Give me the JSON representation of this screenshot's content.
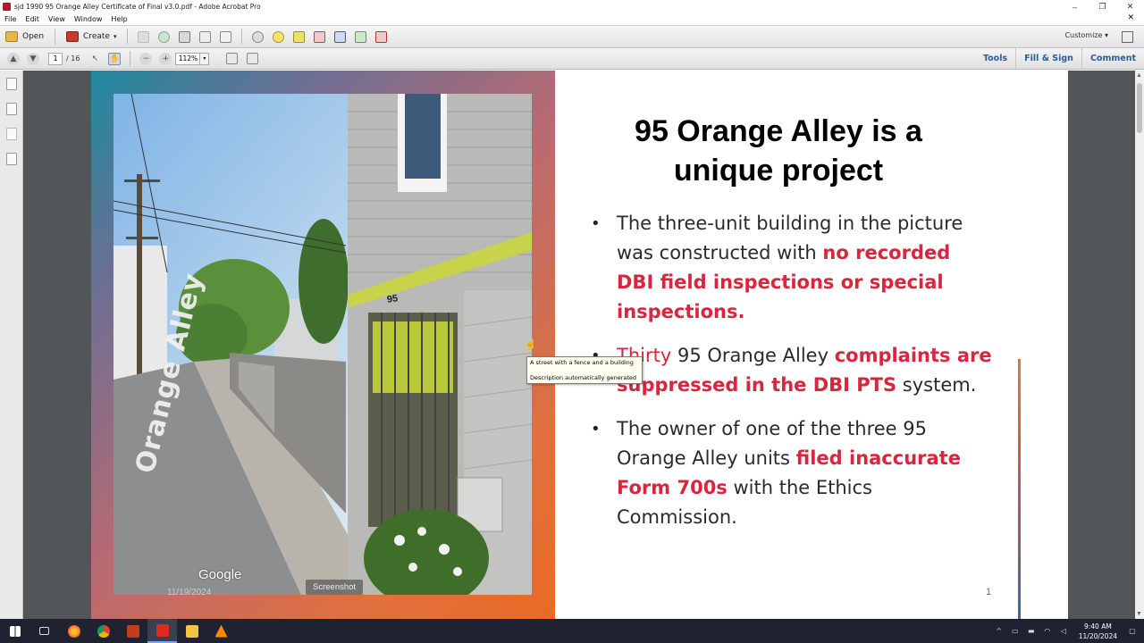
{
  "window": {
    "title": "sjd 1990  95 Orange Alley Certificate of Final v3.0.pdf - Adobe Acrobat Pro",
    "controls": [
      "–",
      "❐",
      "✕"
    ]
  },
  "menu": {
    "items": [
      "File",
      "Edit",
      "View",
      "Window",
      "Help"
    ],
    "close_doc": "✕"
  },
  "toolbar": {
    "open_label": "Open",
    "create_label": "Create",
    "create_arrow": "▾",
    "customize_label": "Customize ▾"
  },
  "nav": {
    "page_current": "1",
    "page_total": "/ 16",
    "zoom_value": "112%",
    "zoom_arrow": "▾",
    "tools_label": "Tools",
    "fill_sign_label": "Fill & Sign",
    "comment_label": "Comment"
  },
  "slide": {
    "title_line1": "95 Orange Alley is a",
    "title_line2": "unique project",
    "bullet1_text": "The three-unit building in the picture was constructed with ",
    "bullet1_red": "no recorded DBI field inspections or special inspections.",
    "bullet2_red_a": "Thirty",
    "bullet2_text": " 95 Orange Alley ",
    "bullet2_red_b": "complaints are suppressed in the DBI PTS",
    "bullet2_tail": " system.",
    "bullet3_text_a": "The owner of one of the three 95 Orange Alley units ",
    "bullet3_red": "filed inaccurate Form 700s",
    "bullet3_text_b": " with the Ethics Commission.",
    "page_number": "1",
    "bullet_glyph": "•"
  },
  "photo": {
    "watermark": "Google",
    "date": "11/19/2024",
    "badge": "Screenshot",
    "street_text": "Orange Alley",
    "house_number": "95"
  },
  "tooltip": {
    "line1": "A street with a fence and a building",
    "line2": "Description automatically generated"
  },
  "taskbar": {
    "time": "9:40 AM",
    "date": "11/20/2024"
  },
  "colors": {
    "accent_red": "#d7263d",
    "link_blue": "#2c5c9c",
    "taskbar_bg": "#1f2230"
  }
}
